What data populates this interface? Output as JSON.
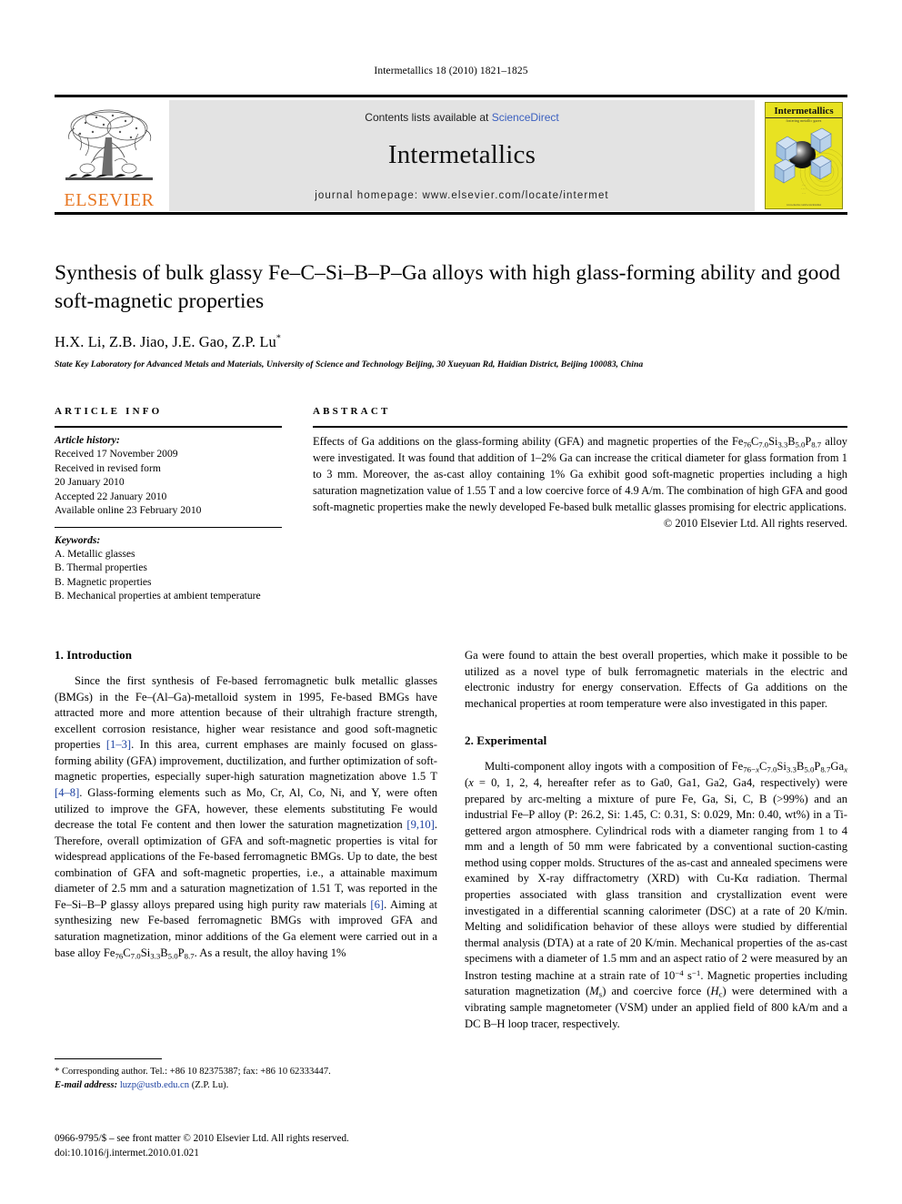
{
  "running_head": "Intermetallics 18 (2010) 1821–1825",
  "masthead": {
    "publisher_name": "ELSEVIER",
    "contents_prefix": "Contents lists available at ",
    "sciencedirect": "ScienceDirect",
    "journal_name": "Intermetallics",
    "homepage": "journal homepage: www.elsevier.com/locate/intermet",
    "cover": {
      "title": "Intermetallics",
      "subtitle": "fostering metallic gazes",
      "footer": "www.elsevier.com/locate/intermet"
    }
  },
  "article": {
    "title": "Synthesis of bulk glassy Fe–C–Si–B–P–Ga alloys with high glass-forming ability and good soft-magnetic properties",
    "authors": "H.X. Li, Z.B. Jiao, J.E. Gao, Z.P. Lu",
    "corresponding_marker": "*",
    "affiliation": "State Key Laboratory for Advanced Metals and Materials, University of Science and Technology Beijing, 30 Xueyuan Rd, Haidian District, Beijing 100083, China"
  },
  "article_info": {
    "heading": "ARTICLE INFO",
    "history_label": "Article history:",
    "history": [
      "Received 17 November 2009",
      "Received in revised form",
      "20 January 2010",
      "Accepted 22 January 2010",
      "Available online 23 February 2010"
    ],
    "keywords_label": "Keywords:",
    "keywords": [
      "A. Metallic glasses",
      "B. Thermal properties",
      "B. Magnetic properties",
      "B. Mechanical properties at ambient temperature"
    ]
  },
  "abstract": {
    "heading": "ABSTRACT",
    "copyright": "© 2010 Elsevier Ltd. All rights reserved."
  },
  "sections": {
    "intro_heading": "1. Introduction",
    "experimental_heading": "2. Experimental"
  },
  "footnote": {
    "corresponding": "* Corresponding author. Tel.: +86 10 82375387; fax: +86 10 62333447.",
    "email_label": "E-mail address:",
    "email": "luzp@ustb.edu.cn",
    "email_owner": "(Z.P. Lu).",
    "issn_line": "0966-9795/$ – see front matter © 2010 Elsevier Ltd. All rights reserved.",
    "doi_line": "doi:10.1016/j.intermet.2010.01.021"
  },
  "colors": {
    "elsevier_orange": "#E87722",
    "banner_gray": "#e3e3e3",
    "link_blue": "#3a5fbf",
    "ref_blue": "#1a3fa0",
    "cover_yellow": "#E8E222"
  }
}
